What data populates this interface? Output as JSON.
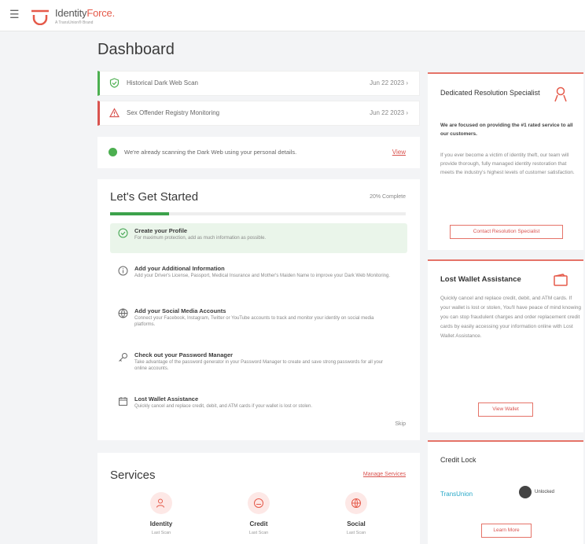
{
  "header": {
    "brand_prefix": "Identity",
    "brand_accent": "Force",
    "brand_suffix": ".",
    "brand_sub": "A TransUnion® Brand"
  },
  "page": {
    "title": "Dashboard"
  },
  "alerts": [
    {
      "icon": "shield-check-icon",
      "text": "Historical Dark Web Scan",
      "date": "Jun 22 2023",
      "status_color": "#4caf50"
    },
    {
      "icon": "warning-triangle-icon",
      "text": "Sex Offender Registry Monitoring",
      "date": "Jun 22 2023",
      "status_color": "#d9534f"
    }
  ],
  "scan_notice": {
    "text": "We're already scanning the Dark Web using your personal details.",
    "link": "View"
  },
  "getting_started": {
    "title": "Let's Get Started",
    "percent_label": "20% Complete",
    "progress_fraction": 0.2,
    "steps": [
      {
        "title": "Create your Profile",
        "desc": "For maximum protection, add as much information as possible."
      },
      {
        "title": "Add your Additional Information",
        "desc": "Add your Driver's License, Passport, Medical Insurance and Mother's Maiden Name to improve your Dark Web Monitoring."
      },
      {
        "title": "Add your Social Media Accounts",
        "desc": "Connect your Facebook, Instagram, Twitter or YouTube accounts to track and monitor your identity on social media platforms."
      },
      {
        "title": "Check out your Password Manager",
        "desc": "Take advantage of the password generator in your Password Manager to create and save strong passwords for all your online accounts."
      },
      {
        "title": "Lost Wallet Assistance",
        "desc": "Quickly cancel and replace credit, debit, and ATM cards if your wallet is lost or stolen."
      }
    ],
    "skip_label": "Skip"
  },
  "services": {
    "title": "Services",
    "manage_label": "Manage Services",
    "items": [
      {
        "label": "Identity",
        "sub": "Last Scan"
      },
      {
        "label": "Credit",
        "sub": "Last Scan"
      },
      {
        "label": "Social",
        "sub": "Last Scan"
      }
    ]
  },
  "resolution": {
    "title": "Dedicated Resolution Specialist",
    "bold": "We are focused on providing the #1 rated service to all our customers.",
    "body": "If you ever become a victim of identity theft, our team will provide thorough, fully managed identity restoration that meets the industry's highest levels of customer satisfaction.",
    "button": "Contact Resolution Specialist"
  },
  "wallet": {
    "title": "Lost Wallet Assistance",
    "body": "Quickly cancel and replace credit, debit, and ATM cards. If your wallet is lost or stolen, You'll have peace of mind knowing you can stop fraudulent charges and order replacement credit cards by easily accessing your information online with Lost Wallet Assistance.",
    "button": "View Wallet"
  },
  "credit_lock": {
    "title": "Credit Lock",
    "transunion": "TransUnion",
    "equifax": "Unlocked",
    "button": "Learn More"
  },
  "colors": {
    "accent": "#e55a4a",
    "green": "#3ca24b"
  }
}
